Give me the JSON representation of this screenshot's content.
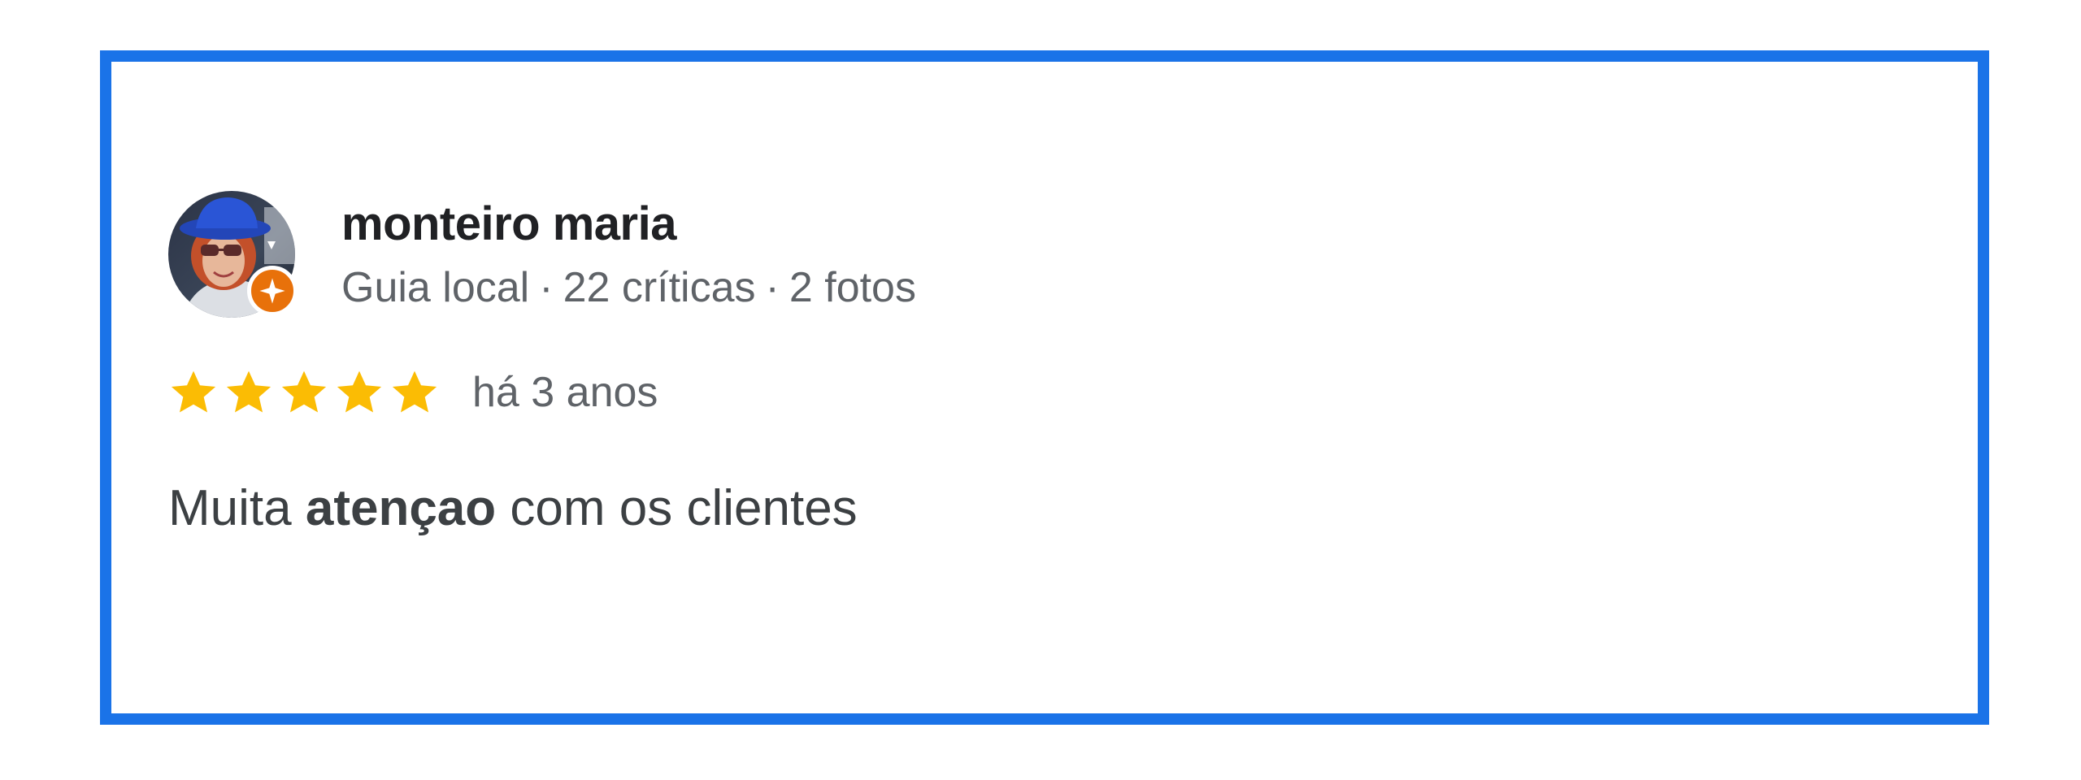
{
  "colors": {
    "card_border": "#1a73e8",
    "star": "#fbbc04",
    "guide_badge": "#e8710a",
    "name_text": "#202124",
    "meta_text": "#5f6368",
    "review_text": "#3c4043"
  },
  "review": {
    "author": {
      "name": "monteiro maria",
      "avatar_icon": "user-photo",
      "badge_icon": "local-guide-badge-icon",
      "meta": {
        "level": "Guia local",
        "separator": "·",
        "reviews": "22 críticas",
        "photos": "2 fotos"
      }
    },
    "rating": {
      "stars": 5,
      "max_stars": 5,
      "star_icon": "star-icon"
    },
    "time": "há 3 anos",
    "text": {
      "before": "Muita ",
      "highlight": "atençao",
      "after": " com os clientes"
    }
  }
}
